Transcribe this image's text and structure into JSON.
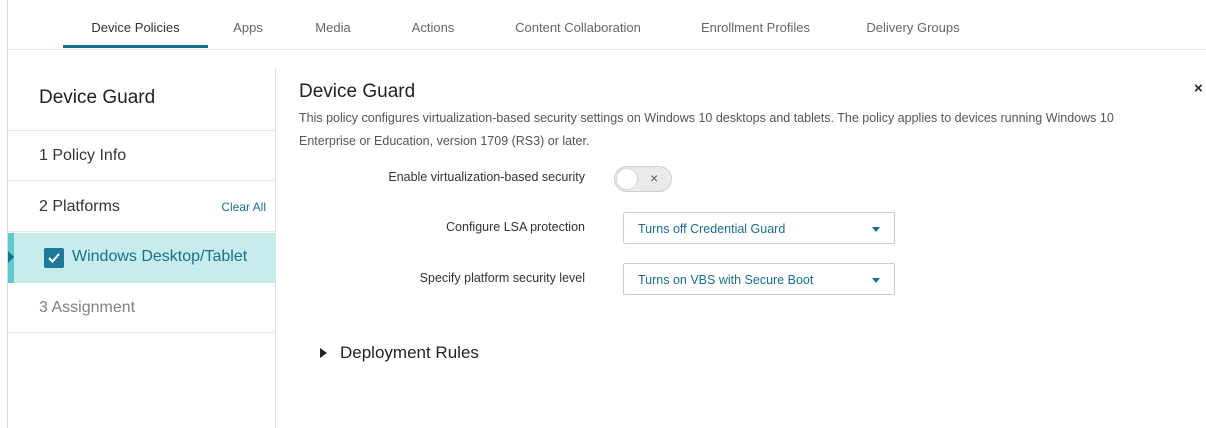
{
  "tabs": [
    {
      "label": "Device Policies",
      "active": true
    },
    {
      "label": "Apps"
    },
    {
      "label": "Media"
    },
    {
      "label": "Actions"
    },
    {
      "label": "Content Collaboration"
    },
    {
      "label": "Enrollment Profiles"
    },
    {
      "label": "Delivery Groups"
    }
  ],
  "sidebar": {
    "title": "Device Guard",
    "steps": [
      {
        "label": "1 Policy Info"
      },
      {
        "label": "2 Platforms",
        "action": "Clear All"
      },
      {
        "label": "Windows Desktop/Tablet",
        "checked": true
      },
      {
        "label": "3 Assignment"
      }
    ]
  },
  "main": {
    "title": "Device Guard",
    "description": "This policy configures virtualization-based security settings on Windows 10 desktops and tablets. The policy applies to devices running Windows 10 Enterprise or Education, version 1709 (RS3) or later.",
    "fields": [
      {
        "label": "Enable virtualization-based security",
        "type": "toggle",
        "value": "off",
        "toggle_glyph": "×"
      },
      {
        "label": "Configure LSA protection",
        "type": "select",
        "value": "Turns off Credential Guard"
      },
      {
        "label": "Specify platform security level",
        "type": "select",
        "value": "Turns on VBS with Secure Boot"
      }
    ],
    "deployment_rules": "Deployment Rules",
    "close_glyph": "×"
  },
  "colors": {
    "accent": "#1a6f8e",
    "selected_bg": "#c7ecec",
    "selected_border": "#5fc9cf"
  }
}
